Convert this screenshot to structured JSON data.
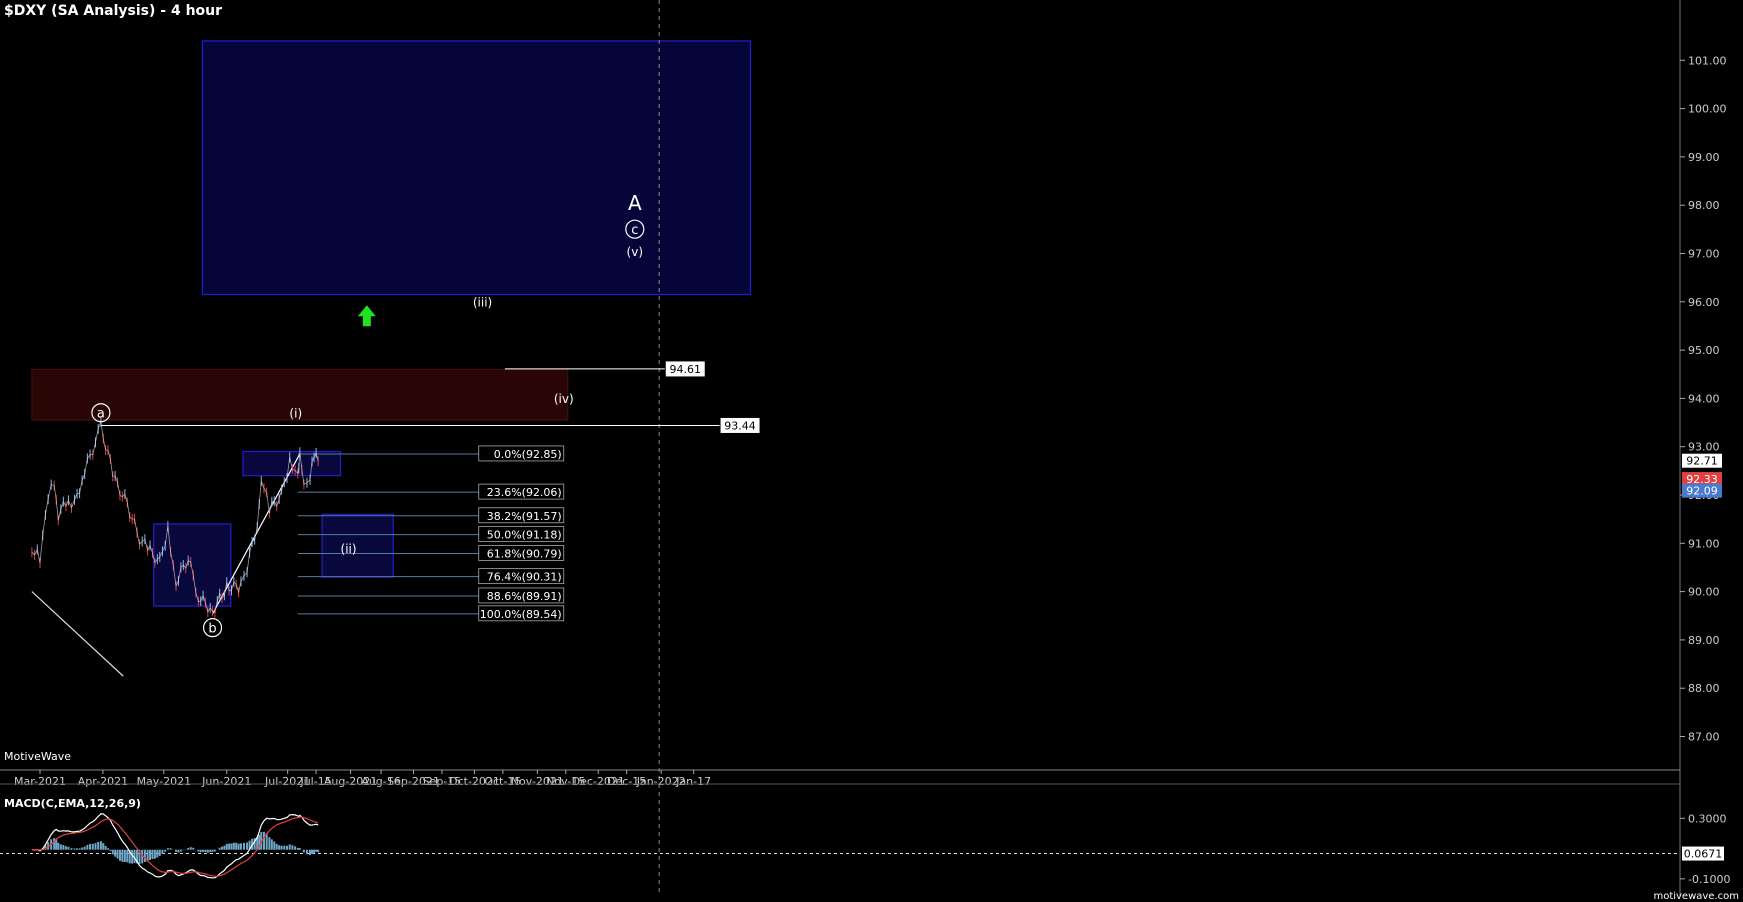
{
  "header": {
    "title": "$DXY (SA Analysis) - 4 hour"
  },
  "footer": {
    "brand": "MotiveWave",
    "site": "motivewave.com"
  },
  "chart_data": {
    "type": "line",
    "symbol": "$DXY",
    "timeframe": "4 hour",
    "x_ticks": [
      {
        "label": "Mar-2021",
        "date": "2021-03-01"
      },
      {
        "label": "Apr-2021",
        "date": "2021-04-01"
      },
      {
        "label": "May-2021",
        "date": "2021-05-01"
      },
      {
        "label": "Jun-2021",
        "date": "2021-06-01"
      },
      {
        "label": "Jul-2021",
        "date": "2021-07-01"
      },
      {
        "label": "Jul-15",
        "date": "2021-07-15"
      },
      {
        "label": "Aug-2021",
        "date": "2021-08-01"
      },
      {
        "label": "Aug-16",
        "date": "2021-08-16"
      },
      {
        "label": "Sep-2021",
        "date": "2021-09-01"
      },
      {
        "label": "Sep-15",
        "date": "2021-09-15"
      },
      {
        "label": "Oct-2021",
        "date": "2021-10-01"
      },
      {
        "label": "Oct-15",
        "date": "2021-10-15"
      },
      {
        "label": "Nov-2021",
        "date": "2021-11-01"
      },
      {
        "label": "Nov-15",
        "date": "2021-11-15"
      },
      {
        "label": "Dec-2021",
        "date": "2021-12-01"
      },
      {
        "label": "Dec-15",
        "date": "2021-12-15"
      },
      {
        "label": "Jan-2022",
        "date": "2022-01-01"
      },
      {
        "label": "Jan-17",
        "date": "2022-01-17"
      }
    ],
    "y_ticks": [
      "87.00",
      "88.00",
      "89.00",
      "90.00",
      "91.00",
      "92.00",
      "93.00",
      "94.00",
      "95.00",
      "96.00",
      "97.00",
      "98.00",
      "99.00",
      "100.00",
      "101.00"
    ],
    "ylim": [
      86.6,
      101.6
    ],
    "price_series": [
      {
        "date": "2021-02-25",
        "value": 90.9
      },
      {
        "date": "2021-03-01",
        "value": 90.7
      },
      {
        "date": "2021-03-05",
        "value": 91.9
      },
      {
        "date": "2021-03-08",
        "value": 92.3
      },
      {
        "date": "2021-03-10",
        "value": 91.6
      },
      {
        "date": "2021-03-15",
        "value": 91.9
      },
      {
        "date": "2021-03-18",
        "value": 91.8
      },
      {
        "date": "2021-03-23",
        "value": 92.5
      },
      {
        "date": "2021-03-31",
        "value": 93.4
      },
      {
        "date": "2021-04-07",
        "value": 92.3
      },
      {
        "date": "2021-04-13",
        "value": 91.8
      },
      {
        "date": "2021-04-19",
        "value": 91.1
      },
      {
        "date": "2021-04-23",
        "value": 90.9
      },
      {
        "date": "2021-04-29",
        "value": 90.6
      },
      {
        "date": "2021-05-03",
        "value": 91.3
      },
      {
        "date": "2021-05-07",
        "value": 90.2
      },
      {
        "date": "2021-05-13",
        "value": 90.7
      },
      {
        "date": "2021-05-18",
        "value": 89.9
      },
      {
        "date": "2021-05-25",
        "value": 89.6
      },
      {
        "date": "2021-06-01",
        "value": 90.1
      },
      {
        "date": "2021-06-08",
        "value": 90.1
      },
      {
        "date": "2021-06-11",
        "value": 90.5
      },
      {
        "date": "2021-06-16",
        "value": 91.4
      },
      {
        "date": "2021-06-18",
        "value": 92.4
      },
      {
        "date": "2021-06-22",
        "value": 91.7
      },
      {
        "date": "2021-06-28",
        "value": 92.0
      },
      {
        "date": "2021-07-02",
        "value": 92.7
      },
      {
        "date": "2021-07-06",
        "value": 92.5
      },
      {
        "date": "2021-07-07",
        "value": 92.8
      },
      {
        "date": "2021-07-09",
        "value": 92.1
      },
      {
        "date": "2021-07-12",
        "value": 92.4
      },
      {
        "date": "2021-07-14",
        "value": 92.8
      },
      {
        "date": "2021-07-16",
        "value": 92.7
      }
    ],
    "price_labels": [
      {
        "text": "92.71",
        "value": 92.71,
        "style": "white"
      },
      {
        "text": "92.33",
        "value": 92.33,
        "style": "red"
      },
      {
        "text": "92.09",
        "value": 92.09,
        "style": "blue"
      }
    ],
    "levels": [
      {
        "label": "94.61",
        "value": 94.61
      },
      {
        "label": "93.44",
        "value": 93.44
      }
    ],
    "fibonacci": [
      {
        "label": "0.0%(92.85)",
        "value": 92.85
      },
      {
        "label": "23.6%(92.06)",
        "value": 92.06
      },
      {
        "label": "38.2%(91.57)",
        "value": 91.57
      },
      {
        "label": "50.0%(91.18)",
        "value": 91.18
      },
      {
        "label": "61.8%(90.79)",
        "value": 90.79
      },
      {
        "label": "76.4%(90.31)",
        "value": 90.31
      },
      {
        "label": "88.6%(89.91)",
        "value": 89.91
      },
      {
        "label": "100.0%(89.54)",
        "value": 89.54
      }
    ],
    "zones": [
      {
        "from": "2021-05-20",
        "to": "2022-02-14",
        "low": 96.15,
        "high": 101.4,
        "color": "#05053a"
      },
      {
        "from": "2021-02-25",
        "to": "2021-11-16",
        "low": 93.55,
        "high": 94.6,
        "color": "#2a0505"
      },
      {
        "from": "2021-04-26",
        "to": "2021-06-03",
        "low": 89.7,
        "high": 91.4,
        "color": "#08083c"
      },
      {
        "from": "2021-06-09",
        "to": "2021-07-27",
        "low": 92.4,
        "high": 92.9,
        "color": "#08083c"
      },
      {
        "from": "2021-07-18",
        "to": "2021-08-22",
        "low": 90.3,
        "high": 91.6,
        "color": "#08083c"
      }
    ],
    "wave_labels": [
      {
        "text": "a",
        "date": "2021-03-31",
        "value": 93.6,
        "circled": true
      },
      {
        "text": "b",
        "date": "2021-05-25",
        "value": 89.15,
        "circled": true
      },
      {
        "text": "(i)",
        "date": "2021-07-05",
        "value": 93.6,
        "circled": false
      },
      {
        "text": "(ii)",
        "date": "2021-07-31",
        "value": 90.8,
        "circled": false
      },
      {
        "text": "(iii)",
        "date": "2021-10-05",
        "value": 95.9,
        "circled": false
      },
      {
        "text": "(iv)",
        "date": "2021-11-14",
        "value": 93.9,
        "circled": false
      },
      {
        "text": "(v)",
        "date": "2021-12-19",
        "value": 96.95,
        "circled": false
      },
      {
        "text": "c",
        "date": "2021-12-19",
        "value": 97.4,
        "circled": true
      },
      {
        "text": "A",
        "date": "2021-12-19",
        "value": 97.9,
        "circled": false
      }
    ],
    "vertical_marker_date": "2021-12-31",
    "macd": {
      "title": "MACD(C,EMA,12,26,9)",
      "y_ticks": [
        "-0.1000",
        "0.3000"
      ],
      "ylim": [
        -0.2,
        0.5
      ],
      "value_label": "0.0671",
      "value": 0.0671
    }
  }
}
